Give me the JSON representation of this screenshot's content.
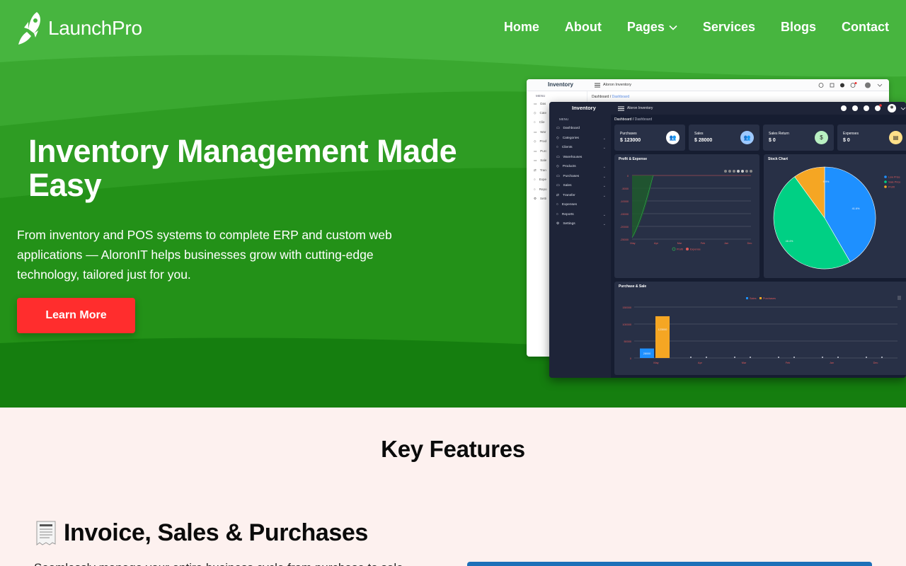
{
  "brand": {
    "name": "LaunchPro",
    "logo_icon": "rocket-icon"
  },
  "nav": [
    {
      "label": "Home"
    },
    {
      "label": "About"
    },
    {
      "label": "Pages",
      "has_dropdown": true
    },
    {
      "label": "Services"
    },
    {
      "label": "Blogs"
    },
    {
      "label": "Contact"
    }
  ],
  "hero": {
    "title": "Inventory Management Made Easy",
    "subtitle": "From inventory and POS systems to complete ERP and custom web applications — AloronIT helps businesses grow with cutting-edge technology, tailored just for you.",
    "cta": "Learn More"
  },
  "colors": {
    "hero_green": "#1f8d14",
    "cta_red": "#ff2d2d",
    "page_bg": "#fdf1ef"
  },
  "mockup": {
    "logo": "Inventory",
    "app_name": "Aloron Inventory",
    "menu_label": "MENU",
    "breadcrumb_root": "Dashboard /",
    "breadcrumb_current": "Dashboard",
    "sidebar": [
      {
        "label": "Dashboard",
        "icon": "calendar-icon",
        "chevron": false
      },
      {
        "label": "Categories",
        "icon": "tag-icon",
        "chevron": true
      },
      {
        "label": "Clients",
        "icon": "users-icon",
        "chevron": true
      },
      {
        "label": "Warehouses",
        "icon": "warehouse-icon",
        "chevron": false
      },
      {
        "label": "Products",
        "icon": "box-icon",
        "chevron": true
      },
      {
        "label": "Purchases",
        "icon": "bag-icon",
        "chevron": true
      },
      {
        "label": "Sales",
        "icon": "cart-icon",
        "chevron": true
      },
      {
        "label": "Transfer",
        "icon": "transfer-icon",
        "chevron": true
      },
      {
        "label": "Expenses",
        "icon": "wallet-icon",
        "chevron": false
      },
      {
        "label": "Reports",
        "icon": "report-icon",
        "chevron": true
      },
      {
        "label": "Settings",
        "icon": "gear-icon",
        "chevron": true
      }
    ],
    "back_sidebar": [
      "Das",
      "Cate",
      "Clie",
      "War",
      "Prod",
      "Purc",
      "Sale",
      "Tran",
      "Expe",
      "Repo",
      "Setti"
    ],
    "cards": [
      {
        "label": "Purchases",
        "value": "$ 123000",
        "icon_color": "#ffffff"
      },
      {
        "label": "Sales",
        "value": "$ 28000",
        "icon_color": "#9ec9ff"
      },
      {
        "label": "Sales Return",
        "value": "$ 0",
        "icon_color": "#b9f0c2"
      },
      {
        "label": "Expenses",
        "value": "$ 0",
        "icon_color": "#ffe089"
      }
    ],
    "profit_panel": {
      "title": "Profit & Expense",
      "legend": [
        "Profit",
        "Expense"
      ],
      "y_ticks": [
        "0",
        "-5000",
        "-10000",
        "-15000",
        "-20000",
        "-25000"
      ],
      "x_ticks": [
        "May",
        "Apr",
        "Mar",
        "Feb",
        "Jan",
        "Dec"
      ]
    },
    "stock_panel": {
      "title": "Stock Chart",
      "legend": [
        "Low Price",
        "Sale Price",
        "Profit"
      ],
      "slices": [
        {
          "label": "Low Price",
          "value": 41.6,
          "color": "#1e90ff"
        },
        {
          "label": "Sale Price",
          "value": 48.4,
          "color": "#00d084"
        },
        {
          "label": "Profit",
          "value": 10.0,
          "color": "#f5a623"
        }
      ],
      "slice_labels": [
        "41.6%",
        "48.4%",
        "9.9%"
      ]
    },
    "purchase_panel": {
      "title": "Purchase & Sale",
      "legend": [
        "Sales",
        "Purchases"
      ],
      "y_ticks": [
        "150000",
        "100000",
        "50000",
        "0"
      ],
      "x_ticks": [
        "May",
        "Apr",
        "Mar",
        "Feb",
        "Jan",
        "Dec"
      ],
      "sales_label": "28000",
      "purchases_label": "123000"
    }
  },
  "chart_data": [
    {
      "type": "pie",
      "title": "Stock Chart",
      "categories": [
        "Low Price",
        "Sale Price",
        "Profit"
      ],
      "values": [
        41.6,
        48.4,
        9.9
      ]
    },
    {
      "type": "bar",
      "title": "Purchase & Sale",
      "categories": [
        "May",
        "Apr",
        "Mar",
        "Feb",
        "Jan",
        "Dec"
      ],
      "series": [
        {
          "name": "Sales",
          "values": [
            28000,
            0,
            0,
            0,
            0,
            0
          ]
        },
        {
          "name": "Purchases",
          "values": [
            123000,
            0,
            0,
            0,
            0,
            0
          ]
        }
      ],
      "ylim": [
        0,
        150000
      ]
    }
  ],
  "features": {
    "section_title": "Key Features",
    "item_title": "Invoice, Sales & Purchases",
    "item_icon": "receipt-icon",
    "item_text": "Seamlessly manage your entire business cycle from purchase to sale"
  }
}
